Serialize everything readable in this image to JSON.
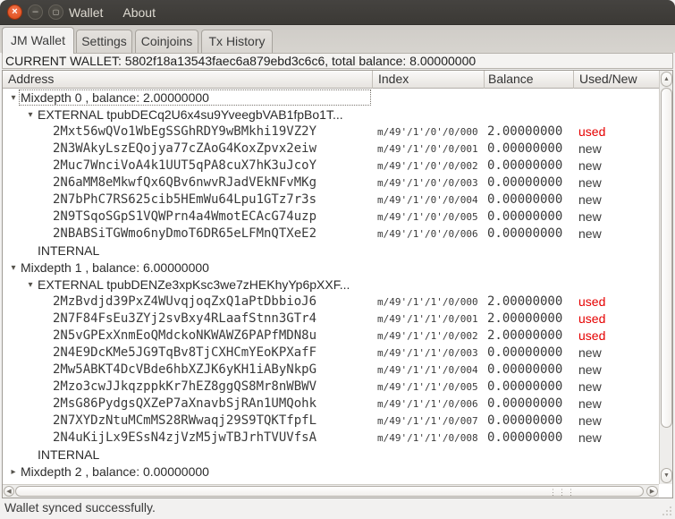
{
  "window": {
    "menu_items": [
      "Wallet",
      "About"
    ],
    "controls": [
      {
        "name": "close",
        "glyph": "×"
      },
      {
        "name": "minimize",
        "glyph": "–"
      },
      {
        "name": "maximize",
        "glyph": "▢"
      }
    ]
  },
  "tabs": [
    {
      "label": "JM Wallet",
      "active": true
    },
    {
      "label": "Settings",
      "active": false
    },
    {
      "label": "Coinjoins",
      "active": false
    },
    {
      "label": "Tx History",
      "active": false
    }
  ],
  "banner": {
    "text": "CURRENT WALLET: 5802f18a13543faec6a879ebd3c6c6, total balance: 8.00000000"
  },
  "tree": {
    "columns": [
      "Address",
      "Index",
      "Balance",
      "Used/New"
    ],
    "rows": [
      {
        "type": "mixdepth",
        "level": 0,
        "expanded": true,
        "focused": true,
        "label": "Mixdepth 0 , balance: 2.00000000"
      },
      {
        "type": "branch",
        "level": 1,
        "expanded": true,
        "label": "EXTERNAL tpubDECq2U6x4su9YveegbVAB1fpBo1T..."
      },
      {
        "type": "address",
        "level": 2,
        "address": "2Mxt56wQVo1WbEgSSGhRDY9wBMkhi19VZ2Y",
        "index": "m/49'/1'/0'/0/000",
        "balance": "2.00000000",
        "status": "used"
      },
      {
        "type": "address",
        "level": 2,
        "address": "2N3WAkyLszEQojya77cZAoG4KoxZpvx2eiw",
        "index": "m/49'/1'/0'/0/001",
        "balance": "0.00000000",
        "status": "new"
      },
      {
        "type": "address",
        "level": 2,
        "address": "2Muc7WnciVoA4k1UUT5qPA8cuX7hK3uJcoY",
        "index": "m/49'/1'/0'/0/002",
        "balance": "0.00000000",
        "status": "new"
      },
      {
        "type": "address",
        "level": 2,
        "address": "2N6aMM8eMkwfQx6QBv6nwvRJadVEkNFvMKg",
        "index": "m/49'/1'/0'/0/003",
        "balance": "0.00000000",
        "status": "new"
      },
      {
        "type": "address",
        "level": 2,
        "address": "2N7bPhC7RS625cib5HEmWu64Lpu1GTz7r3s",
        "index": "m/49'/1'/0'/0/004",
        "balance": "0.00000000",
        "status": "new"
      },
      {
        "type": "address",
        "level": 2,
        "address": "2N9TSqoSGpS1VQWPrn4a4WmotECAcG74uzp",
        "index": "m/49'/1'/0'/0/005",
        "balance": "0.00000000",
        "status": "new"
      },
      {
        "type": "address",
        "level": 2,
        "address": "2NBABSiTGWmo6nyDmoT6DR65eLFMnQTXeE2",
        "index": "m/49'/1'/0'/0/006",
        "balance": "0.00000000",
        "status": "new"
      },
      {
        "type": "branch",
        "level": 1,
        "expanded": null,
        "label": "INTERNAL"
      },
      {
        "type": "mixdepth",
        "level": 0,
        "expanded": true,
        "label": "Mixdepth 1 , balance: 6.00000000"
      },
      {
        "type": "branch",
        "level": 1,
        "expanded": true,
        "label": "EXTERNAL tpubDENZe3xpKsc3we7zHEKhyYp6pXXF..."
      },
      {
        "type": "address",
        "level": 2,
        "address": "2MzBvdjd39PxZ4WUvqjoqZxQ1aPtDbbioJ6",
        "index": "m/49'/1'/1'/0/000",
        "balance": "2.00000000",
        "status": "used"
      },
      {
        "type": "address",
        "level": 2,
        "address": "2N7F84FsEu3ZYj2svBxy4RLaafStnn3GTr4",
        "index": "m/49'/1'/1'/0/001",
        "balance": "2.00000000",
        "status": "used"
      },
      {
        "type": "address",
        "level": 2,
        "address": "2N5vGPExXnmEoQMdckoNKWAWZ6PAPfMDN8u",
        "index": "m/49'/1'/1'/0/002",
        "balance": "2.00000000",
        "status": "used"
      },
      {
        "type": "address",
        "level": 2,
        "address": "2N4E9DcKMe5JG9TqBv8TjCXHCmYEoKPXafF",
        "index": "m/49'/1'/1'/0/003",
        "balance": "0.00000000",
        "status": "new"
      },
      {
        "type": "address",
        "level": 2,
        "address": "2Mw5ABKT4DcVBde6hbXZJK6yKH1iAByNkpG",
        "index": "m/49'/1'/1'/0/004",
        "balance": "0.00000000",
        "status": "new"
      },
      {
        "type": "address",
        "level": 2,
        "address": "2Mzo3cwJJkqzppkKr7hEZ8ggQS8Mr8nWBWV",
        "index": "m/49'/1'/1'/0/005",
        "balance": "0.00000000",
        "status": "new"
      },
      {
        "type": "address",
        "level": 2,
        "address": "2MsG86PydgsQXZeP7aXnavbSjRAn1UMQohk",
        "index": "m/49'/1'/1'/0/006",
        "balance": "0.00000000",
        "status": "new"
      },
      {
        "type": "address",
        "level": 2,
        "address": "2N7XYDzNtuMCmMS28RWwaqj29S9TQKTfpfL",
        "index": "m/49'/1'/1'/0/007",
        "balance": "0.00000000",
        "status": "new"
      },
      {
        "type": "address",
        "level": 2,
        "address": "2N4uKijLx9ESsN4zjVzM5jwTBJrhTVUVfsA",
        "index": "m/49'/1'/1'/0/008",
        "balance": "0.00000000",
        "status": "new"
      },
      {
        "type": "branch",
        "level": 1,
        "expanded": null,
        "label": "INTERNAL"
      },
      {
        "type": "mixdepth",
        "level": 0,
        "expanded": false,
        "label": "Mixdepth 2 , balance: 0.00000000"
      }
    ]
  },
  "statusbar": {
    "text": "Wallet synced successfully."
  },
  "colors": {
    "used": "#e60000",
    "new": "#3c3c3c",
    "titlebar": "#3b3935",
    "close_button": "#dd4814"
  }
}
